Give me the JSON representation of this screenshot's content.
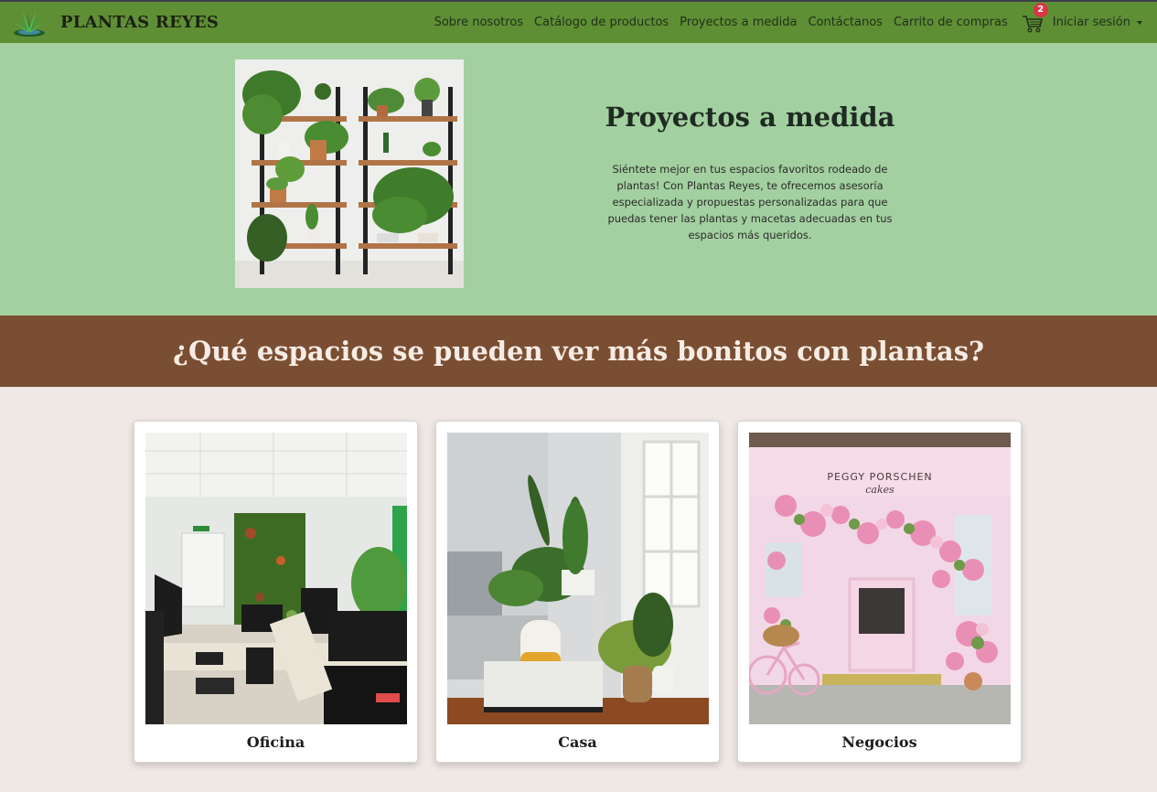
{
  "brand": {
    "name": "PLANTAS REYES",
    "logo_icon": "agave-plant-logo-icon"
  },
  "nav": {
    "items": [
      {
        "label": "Sobre nosotros"
      },
      {
        "label": "Catálogo de productos"
      },
      {
        "label": "Proyectos a medida"
      },
      {
        "label": "Contáctanos"
      },
      {
        "label": "Carrito de compras"
      }
    ],
    "cart_icon": "shopping-cart-icon",
    "cart_count": "2",
    "login_label": "Iniciar sesión"
  },
  "hero": {
    "title": "Proyectos a medida",
    "text": "Siéntete mejor en tus espacios favoritos rodeado de plantas! Con Plantas Reyes, te ofrecemos asesoría especializada y propuestas personalizadas para que puedas tener las plantas y macetas adecuadas en tus espacios más queridos."
  },
  "banner": {
    "title": "¿Qué espacios se pueden ver más bonitos con plantas?"
  },
  "cards": [
    {
      "title": "Oficina"
    },
    {
      "title": "Casa"
    },
    {
      "title": "Negocios",
      "shop_sign": "PEGGY PORSCHEN",
      "shop_sub": "cakes"
    }
  ],
  "colors": {
    "navbar": "#5f8f35",
    "hero_bg": "#a3d0a0",
    "banner_bg": "#7a4e33",
    "page_bg": "#efe8e5",
    "badge": "#dc3545"
  }
}
